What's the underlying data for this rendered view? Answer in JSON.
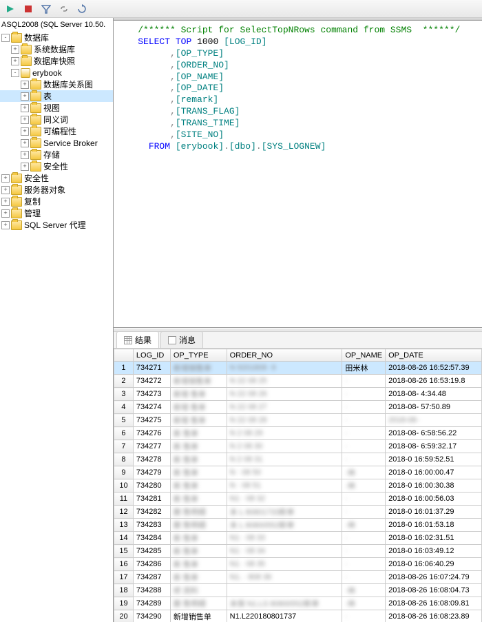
{
  "toolbar": {
    "icons": [
      "execute",
      "stop",
      "filter",
      "link",
      "refresh"
    ]
  },
  "server_label": "ASQL2008 (SQL Server 10.50.",
  "tree": [
    {
      "indent": 0,
      "label": "数据库",
      "toggle": "-",
      "icon": "folder"
    },
    {
      "indent": 1,
      "label": "系统数据库",
      "toggle": "+",
      "icon": "folder"
    },
    {
      "indent": 1,
      "label": "数据库快照",
      "toggle": "+",
      "icon": "folder"
    },
    {
      "indent": 1,
      "label": "erybook",
      "toggle": "-",
      "icon": "db"
    },
    {
      "indent": 2,
      "label": "数据库关系图",
      "toggle": "+",
      "icon": "folder"
    },
    {
      "indent": 2,
      "label": "表",
      "toggle": "+",
      "icon": "folder",
      "selected": true
    },
    {
      "indent": 2,
      "label": "视图",
      "toggle": "+",
      "icon": "folder"
    },
    {
      "indent": 2,
      "label": "同义词",
      "toggle": "+",
      "icon": "folder"
    },
    {
      "indent": 2,
      "label": "可编程性",
      "toggle": "+",
      "icon": "folder"
    },
    {
      "indent": 2,
      "label": "Service Broker",
      "toggle": "+",
      "icon": "folder"
    },
    {
      "indent": 2,
      "label": "存储",
      "toggle": "+",
      "icon": "folder"
    },
    {
      "indent": 2,
      "label": "安全性",
      "toggle": "+",
      "icon": "folder"
    },
    {
      "indent": 0,
      "label": "安全性",
      "toggle": "+",
      "icon": "folder"
    },
    {
      "indent": 0,
      "label": "服务器对象",
      "toggle": "+",
      "icon": "folder"
    },
    {
      "indent": 0,
      "label": "复制",
      "toggle": "+",
      "icon": "folder"
    },
    {
      "indent": 0,
      "label": "管理",
      "toggle": "+",
      "icon": "folder"
    },
    {
      "indent": 0,
      "label": "SQL Server 代理",
      "toggle": "+",
      "icon": "folder"
    }
  ],
  "sql": {
    "comment": "/****** Script for SelectTopNRows command from SSMS  ******/",
    "select": "SELECT",
    "top": "TOP",
    "topn": "1000",
    "cols": [
      "[LOG_ID]",
      "[OP_TYPE]",
      "[ORDER_NO]",
      "[OP_NAME]",
      "[OP_DATE]",
      "[remark]",
      "[TRANS_FLAG]",
      "[TRANS_TIME]",
      "[SITE_NO]"
    ],
    "from": "FROM",
    "table": "[erybook].[dbo].[SYS_LOGNEW]"
  },
  "tabs": {
    "results": "结果",
    "messages": "消息"
  },
  "grid": {
    "headers": [
      "",
      "LOG_ID",
      "OP_TYPE",
      "ORDER_NO",
      "OP_NAME",
      "OP_DATE"
    ],
    "rows": [
      {
        "n": 1,
        "id": "734271",
        "type": "新增销售单",
        "type_smudge": true,
        "order": "N   9201808    ·9",
        "order_smudge": true,
        "name": "田米林",
        "name_smudge": false,
        "date": "2018-08-26 16:52:57.39"
      },
      {
        "n": 2,
        "id": "734272",
        "type": "新增销售单",
        "type_smudge": true,
        "order": "N   22   08   25",
        "order_smudge": true,
        "name": "·",
        "name_smudge": true,
        "date": "2018-08-26 16:53:19.8"
      },
      {
        "n": 3,
        "id": "734273",
        "type": "新增 售单",
        "type_smudge": true,
        "order": "N   22   08   26",
        "order_smudge": true,
        "name": "·",
        "name_smudge": true,
        "date": "2018-08-   4:34.48"
      },
      {
        "n": 4,
        "id": "734274",
        "type": "新增 售单",
        "type_smudge": true,
        "order": "N   22   08   27",
        "order_smudge": true,
        "name": "·",
        "name_smudge": true,
        "date": "2018-08-   57:50.89"
      },
      {
        "n": 5,
        "id": "734275",
        "type": "新增 售单",
        "type_smudge": true,
        "order": "N   22   08   28",
        "order_smudge": true,
        "name": "·",
        "name_smudge": true,
        "date": "2018-08-   ",
        "date_smudge": true
      },
      {
        "n": 6,
        "id": "734276",
        "type": "新  售单",
        "type_smudge": true,
        "order": "N   2    08   29",
        "order_smudge": true,
        "name": "·",
        "name_smudge": true,
        "date": "2018-08-   6:58:56.22"
      },
      {
        "n": 7,
        "id": "734277",
        "type": "新  售单",
        "type_smudge": true,
        "order": "N   2    08   30",
        "order_smudge": true,
        "name": "·",
        "name_smudge": true,
        "date": "2018-08-   6:59:32.17"
      },
      {
        "n": 8,
        "id": "734278",
        "type": "新  售单",
        "type_smudge": true,
        "order": "N   2    08   31",
        "order_smudge": true,
        "name": "·",
        "name_smudge": true,
        "date": "2018-0   16:59:52.51"
      },
      {
        "n": 9,
        "id": "734279",
        "type": "新  售单",
        "type_smudge": true,
        "order": "N   ·    08   50",
        "order_smudge": true,
        "name": "·林",
        "name_smudge": true,
        "date": "2018-0   16:00:00.47"
      },
      {
        "n": 10,
        "id": "734280",
        "type": "新  售单",
        "type_smudge": true,
        "order": "N   ·    08   51",
        "order_smudge": true,
        "name": "·林",
        "name_smudge": true,
        "date": "2018-0   16:00:30.38"
      },
      {
        "n": 11,
        "id": "734281",
        "type": "新  售单",
        "type_smudge": true,
        "order": "N1  ·    08   32",
        "order_smudge": true,
        "name": "·",
        "name_smudge": true,
        "date": "2018-0   16:00:56.03"
      },
      {
        "n": 12,
        "id": "734282",
        "type": "删  售明细",
        "type_smudge": true,
        "order": "未    L   80801733新单",
        "order_smudge": true,
        "name": "·",
        "name_smudge": true,
        "date": "2018-0   16:01:37.29"
      },
      {
        "n": 13,
        "id": "734283",
        "type": "删  售明细",
        "type_smudge": true,
        "order": "未    L   80800552新单",
        "order_smudge": true,
        "name": "·林",
        "name_smudge": true,
        "date": "2018-0   16:01:53.18"
      },
      {
        "n": 14,
        "id": "734284",
        "type": "新  售单",
        "type_smudge": true,
        "order": "N1  ·    08   33",
        "order_smudge": true,
        "name": "·",
        "name_smudge": true,
        "date": "2018-0   16:02:31.51"
      },
      {
        "n": 15,
        "id": "734285",
        "type": "新  售单",
        "type_smudge": true,
        "order": "N1  ·    08   34",
        "order_smudge": true,
        "name": "·",
        "name_smudge": true,
        "date": "2018-0   16:03:49.12"
      },
      {
        "n": 16,
        "id": "734286",
        "type": "新  售单",
        "type_smudge": true,
        "order": "N1  ·    08   35",
        "order_smudge": true,
        "name": "·",
        "name_smudge": true,
        "date": "2018-0   16:06:40.29"
      },
      {
        "n": 17,
        "id": "734287",
        "type": "新  售单",
        "type_smudge": true,
        "order": "N1. ·    808  36",
        "order_smudge": true,
        "name": "·",
        "name_smudge": true,
        "date": "2018-08-26 16:07:24.79"
      },
      {
        "n": 18,
        "id": "734288",
        "type": "修   资料",
        "type_smudge": true,
        "order": "",
        "order_smudge": true,
        "name": "·林",
        "name_smudge": true,
        "date": "2018-08-26 16:08:04.73"
      },
      {
        "n": 19,
        "id": "734289",
        "type": "删  售明细",
        "type_smudge": true,
        "order": "未保   N1.LS   80800552新单",
        "order_smudge": true,
        "name": "·林",
        "name_smudge": true,
        "date": "2018-08-26 16:08:09.81"
      },
      {
        "n": 20,
        "id": "734290",
        "type": "新增销售单",
        "type_smudge": false,
        "order": "N1.L220180801737",
        "order_smudge": false,
        "name": "·",
        "name_smudge": true,
        "date": "2018-08-26 16:08:23.89"
      }
    ]
  }
}
